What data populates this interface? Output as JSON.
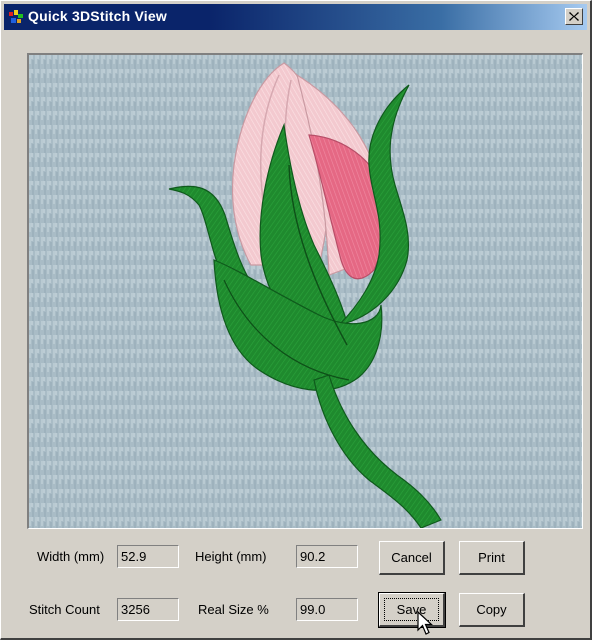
{
  "window": {
    "title": "Quick 3DStitch View",
    "close_glyph": "✕"
  },
  "preview": {
    "background_color": "#a9bcc6",
    "description_icon": "rose-bud-embroidery"
  },
  "fields": {
    "width_label": "Width (mm)",
    "width_value": "52.9",
    "height_label": "Height (mm)",
    "height_value": "90.2",
    "stitch_count_label": "Stitch Count",
    "stitch_count_value": "3256",
    "real_size_label": "Real Size %",
    "real_size_value": "99.0"
  },
  "buttons": {
    "cancel": "Cancel",
    "print": "Print",
    "save": "Save",
    "copy": "Copy"
  },
  "colors": {
    "title_bar": "#0a246a",
    "leaf_green": "#1f8a2e",
    "petal_pink": "#f4c6cc",
    "petal_dark_pink": "#e86a86"
  }
}
